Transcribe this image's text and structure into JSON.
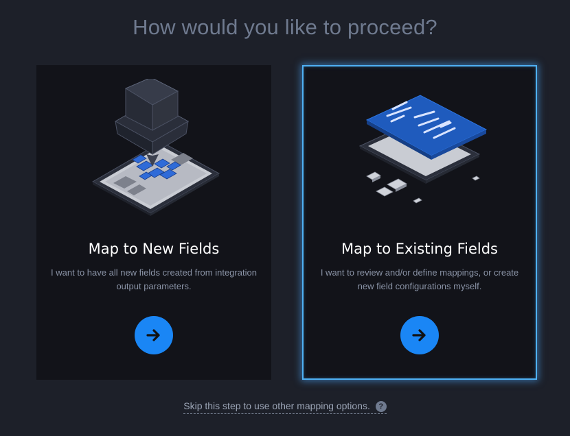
{
  "page": {
    "title": "How would you like to proceed?"
  },
  "cards": [
    {
      "title": "Map to New Fields",
      "description": "I want to have all new fields created from integration output parameters.",
      "button_icon": "arrow-right-icon",
      "selected": false
    },
    {
      "title": "Map to Existing Fields",
      "description": "I want to review and/or define mappings, or create new field configurations myself.",
      "button_icon": "arrow-right-icon",
      "selected": true
    }
  ],
  "footer": {
    "skip_text": "Skip this step to use other mapping options.",
    "help_icon": "question-mark-icon",
    "help_glyph": "?"
  },
  "colors": {
    "background": "#1d2029",
    "card": "#121319",
    "accent": "#1a86f5",
    "selected_border": "#4fb1f5"
  }
}
